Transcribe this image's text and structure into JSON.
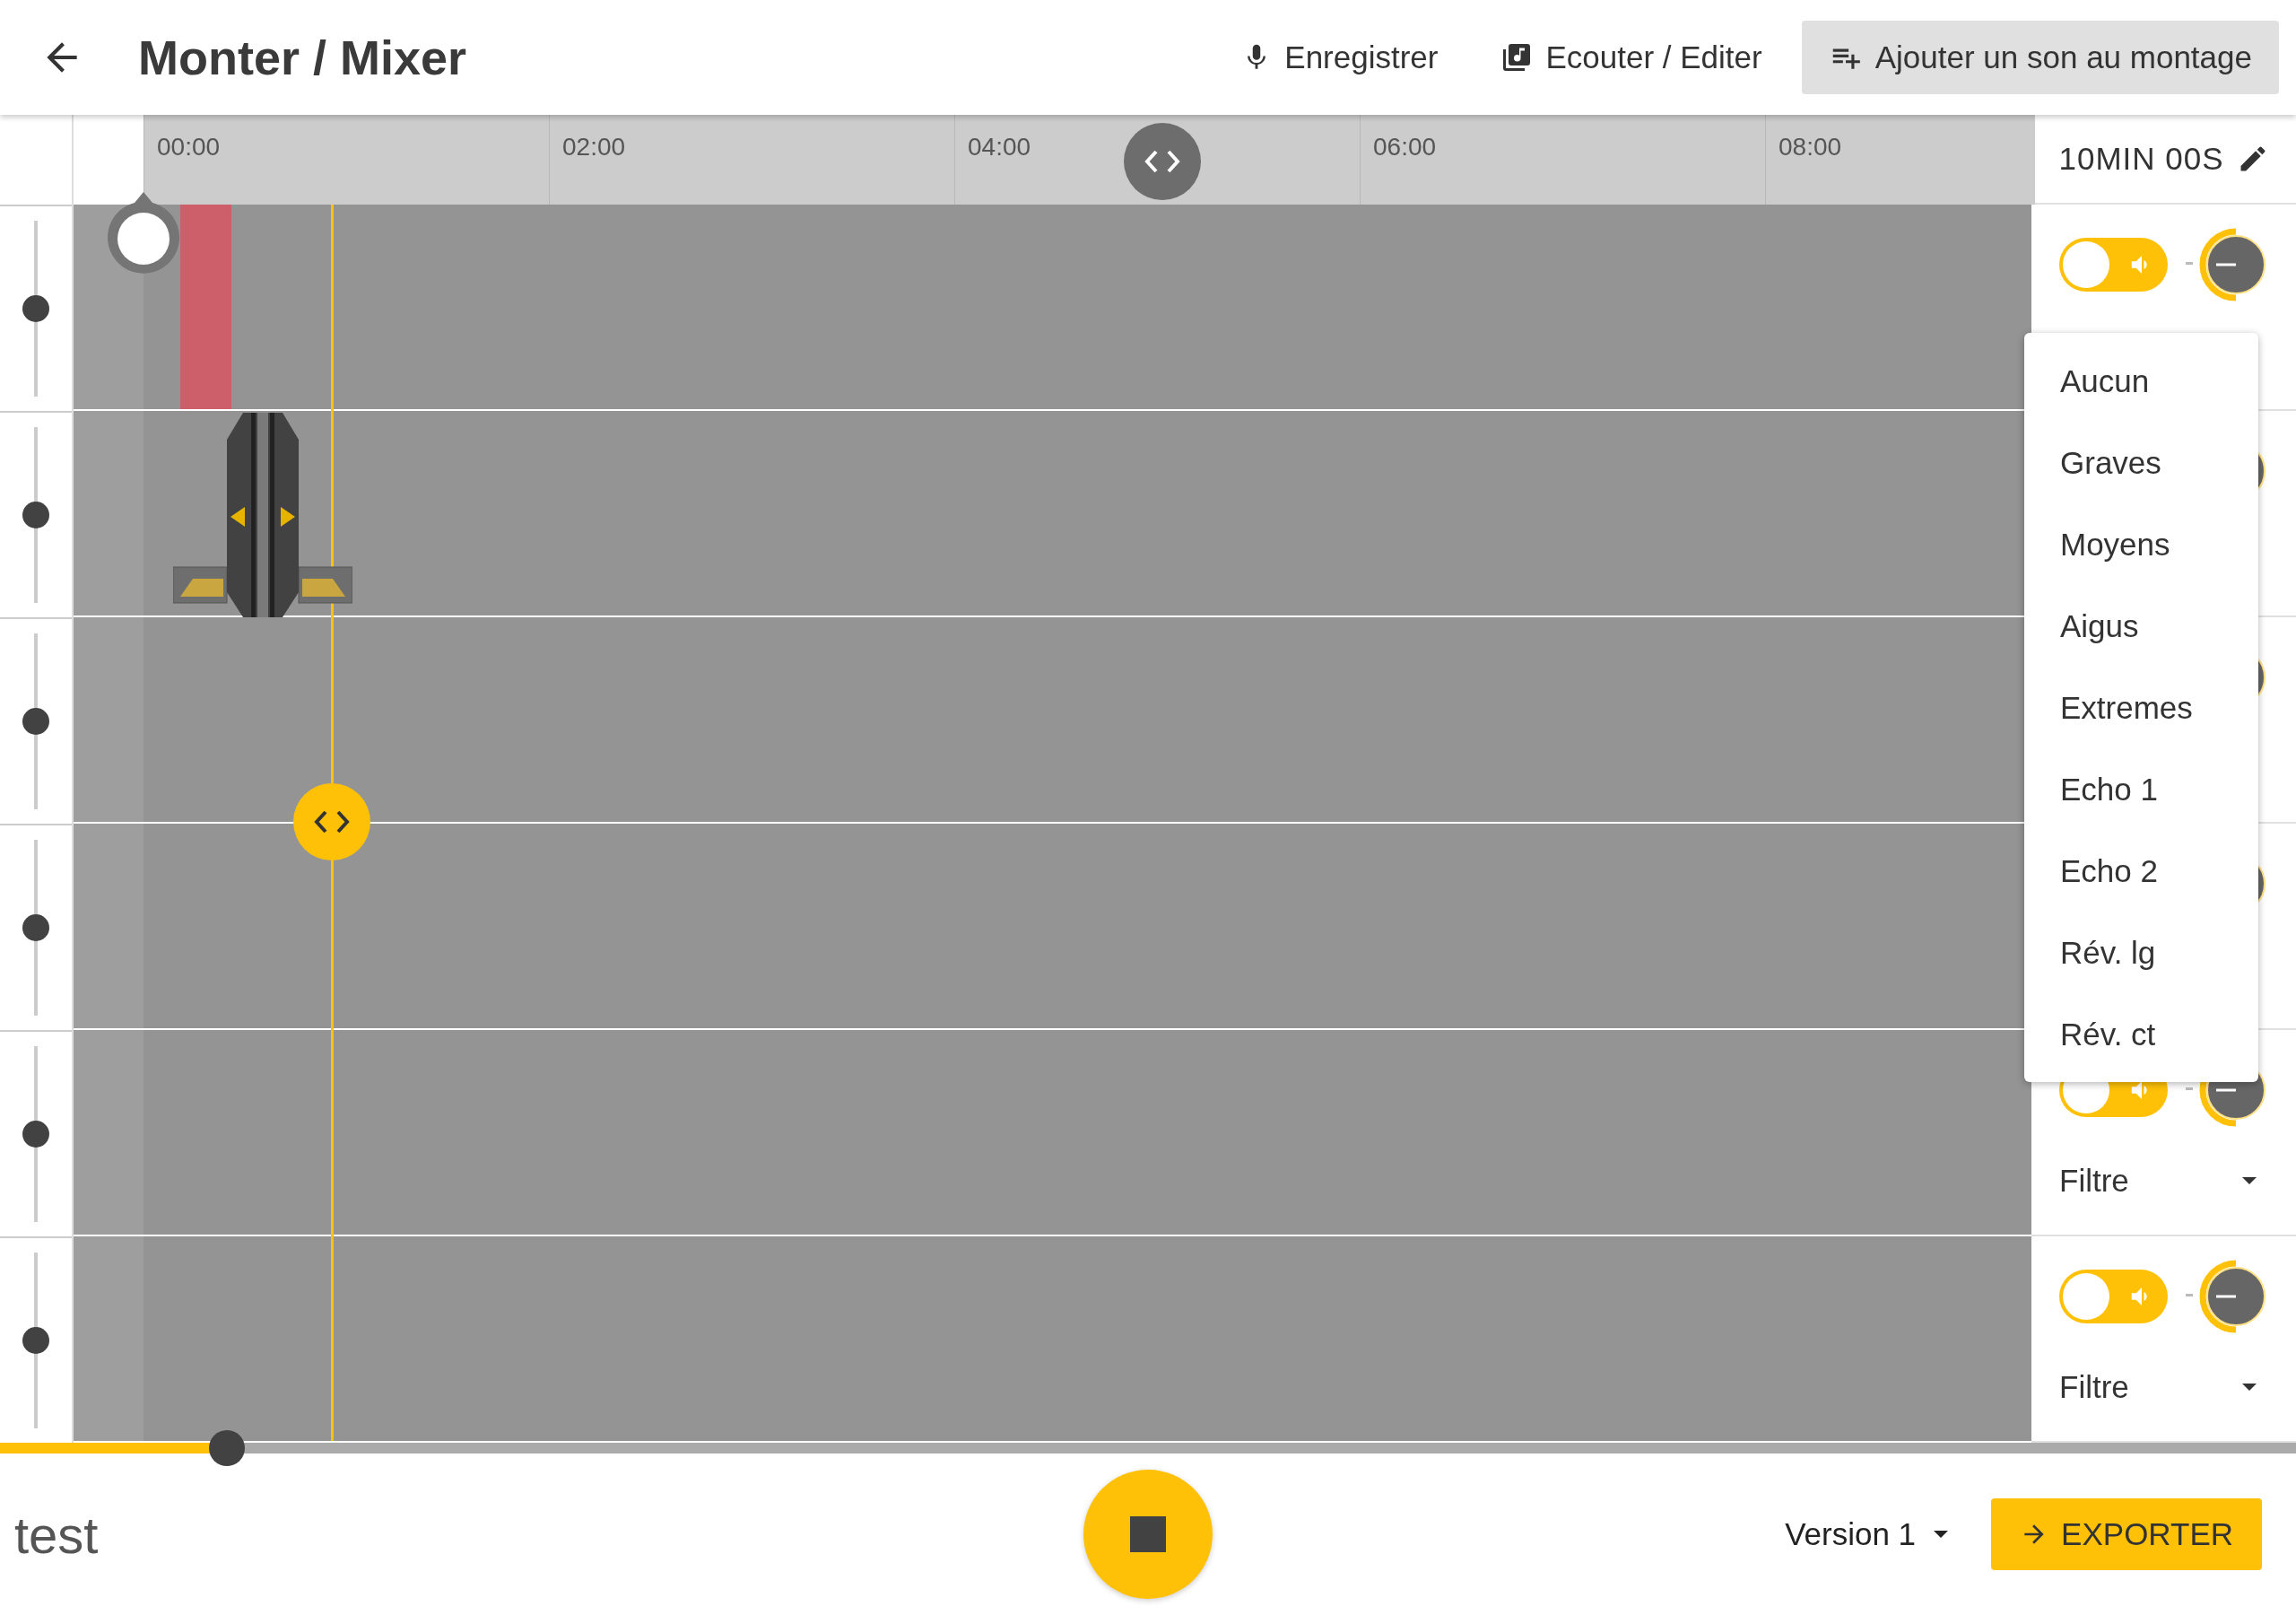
{
  "header": {
    "title": "Monter / Mixer",
    "actions": [
      {
        "kind": "record",
        "label": "Enregistrer"
      },
      {
        "kind": "listen",
        "label": "Ecouter / Editer"
      },
      {
        "kind": "add",
        "label": "Ajouter un son au montage"
      }
    ]
  },
  "timeline": {
    "duration": "10MIN 00S",
    "ticks": [
      "00:00",
      "02:00",
      "04:00",
      "06:00",
      "08:00"
    ]
  },
  "tracks": [
    {
      "volume": {
        "level": 0.5
      },
      "on": true
    },
    {
      "volume": {
        "level": 0.5
      }
    },
    {
      "volume": {
        "level": 0.5
      }
    },
    {
      "volume": {
        "level": 0.5
      }
    },
    {
      "volume": {
        "level": 0.5
      },
      "on": true,
      "filter": "Filtre"
    },
    {
      "volume": {
        "level": 0.5
      },
      "on": true,
      "filter": "Filtre"
    }
  ],
  "filter_menu": {
    "items": [
      "Aucun",
      "Graves",
      "Moyens",
      "Aigus",
      "Extremes",
      "Echo 1",
      "Echo 2",
      "Rév. lg",
      "Rév. ct"
    ]
  },
  "progress": {
    "level": 0.099
  },
  "footer": {
    "name": "test",
    "playing": true,
    "version": "Version 1",
    "export": "EXPORTER"
  }
}
